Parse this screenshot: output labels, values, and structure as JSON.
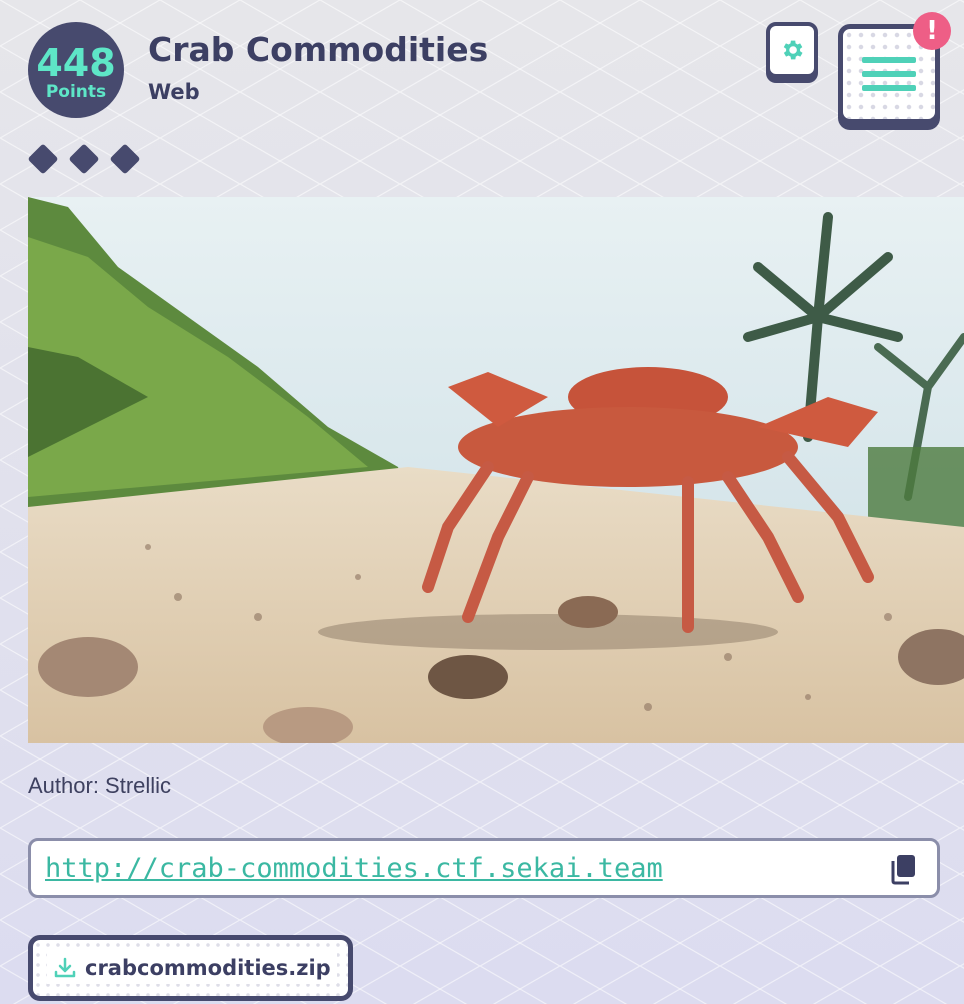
{
  "challenge": {
    "points_value": "448",
    "points_label": "Points",
    "title": "Crab Commodities",
    "category": "Web",
    "difficulty_diamonds": 3,
    "author": "Author: Strellic",
    "url": "http://crab-commodities.ctf.sekai.team",
    "file_name": "crabcommodities.zip"
  },
  "header": {
    "settings_icon": "gear-icon",
    "menu_icon": "hamburger-menu-icon",
    "alert_badge": "!"
  },
  "icons": {
    "copy": "copy-icon",
    "download": "download-icon"
  },
  "colors": {
    "primary": "#474a6e",
    "accent": "#4fd1b8",
    "alert": "#ee5e86",
    "link": "#3bb8a2"
  }
}
